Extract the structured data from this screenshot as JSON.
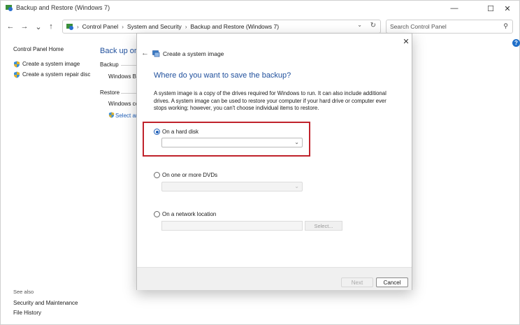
{
  "window": {
    "title": "Backup and Restore (Windows 7)",
    "minimize_glyph": "—",
    "maximize_glyph": "☐",
    "close_glyph": "✕"
  },
  "nav": {
    "back_glyph": "←",
    "forward_glyph": "→",
    "recent_glyph": "⌄",
    "up_glyph": "↑"
  },
  "address": {
    "sep": "›",
    "crumbs": [
      "Control Panel",
      "System and Security",
      "Backup and Restore (Windows 7)"
    ],
    "dropdown_glyph": "⌄",
    "refresh_glyph": "↻"
  },
  "search": {
    "placeholder": "Search Control Panel",
    "icon_glyph": "⚲"
  },
  "help_glyph": "?",
  "left_pane": {
    "home": "Control Panel Home",
    "items": [
      "Create a system image",
      "Create a system repair disc"
    ],
    "see_also_title": "See also",
    "see_also": [
      "Security and Maintenance",
      "File History"
    ]
  },
  "main": {
    "heading_partial": "Back up or r",
    "backup_label": "Backup",
    "backup_value_partial": "Windows Ba",
    "restore_label": "Restore",
    "restore_value_partial": "Windows cc",
    "select_link_partial": "Select an"
  },
  "dialog": {
    "close_glyph": "✕",
    "back_glyph": "←",
    "title": "Create a system image",
    "heading": "Where do you want to save the backup?",
    "description": "A system image is a copy of the drives required for Windows to run. It can also include additional drives. A system image can be used to restore your computer if your hard drive or computer ever stops working; however, you can't choose individual items to restore.",
    "options": [
      {
        "label": "On a hard disk",
        "selected": true
      },
      {
        "label": "On one or more DVDs",
        "selected": false
      },
      {
        "label": "On a network location",
        "selected": false
      }
    ],
    "select_button": "Select...",
    "next_button": "Next",
    "cancel_button": "Cancel",
    "chevron_glyph": "⌄"
  },
  "colors": {
    "link_blue": "#1f5fb8",
    "heading_blue": "#1f4f9c",
    "highlight_red": "#c0222b"
  },
  "icons": [
    "control-panel-icon",
    "shield-icon",
    "system-image-icon"
  ]
}
